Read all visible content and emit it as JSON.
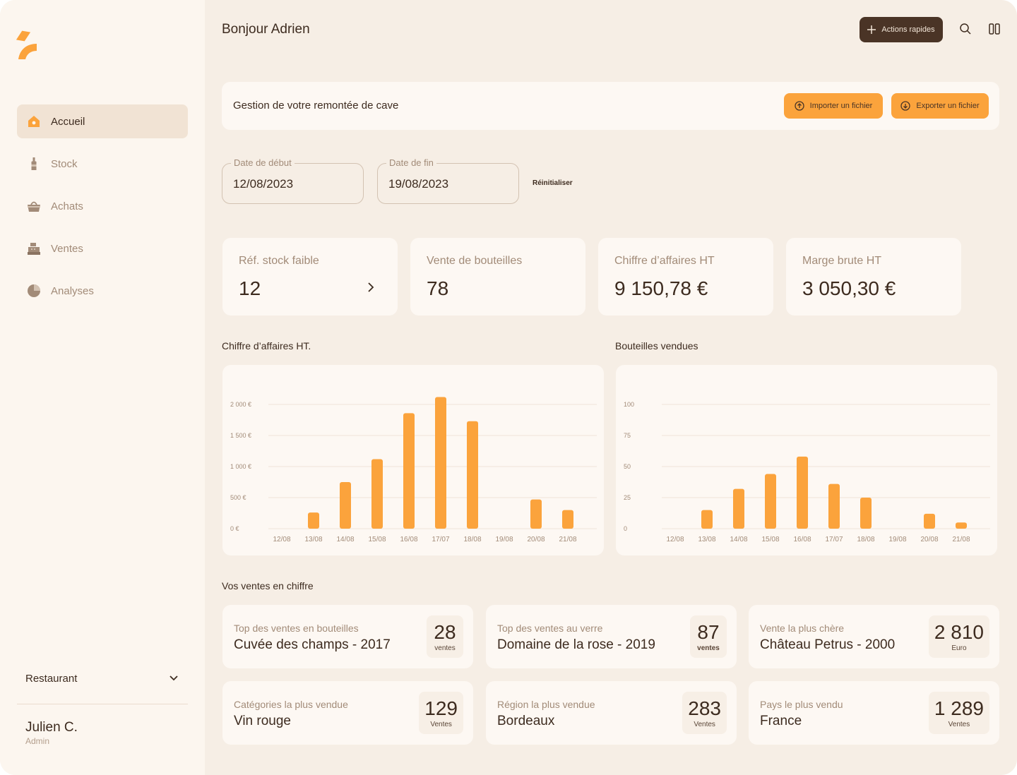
{
  "sidebar": {
    "items": [
      {
        "label": "Accueil",
        "icon": "house-icon"
      },
      {
        "label": "Stock",
        "icon": "bottle-icon"
      },
      {
        "label": "Achats",
        "icon": "basket-icon"
      },
      {
        "label": "Ventes",
        "icon": "cash-register-icon"
      },
      {
        "label": "Analyses",
        "icon": "pie-chart-icon"
      }
    ],
    "restaurant": "Restaurant",
    "user": {
      "name": "Julien C.",
      "role": "Admin"
    }
  },
  "header": {
    "greeting": "Bonjour Adrien",
    "quick_actions": "Actions rapides"
  },
  "banner": {
    "text": "Gestion de votre remontée de cave",
    "import": "Importer un fichier",
    "export": "Exporter un fichier"
  },
  "filters": {
    "start_label": "Date de début",
    "start_value": "12/08/2023",
    "end_label": "Date de fin",
    "end_value": "19/08/2023",
    "reset": "Réinitialiser"
  },
  "kpis": [
    {
      "label": "Réf. stock faible",
      "value": "12"
    },
    {
      "label": "Vente de bouteilles",
      "value": "78"
    },
    {
      "label": "Chiffre d’affaires HT",
      "value": "9 150,78 €"
    },
    {
      "label": "Marge brute HT",
      "value": "3 050,30 €"
    }
  ],
  "chart_data": [
    {
      "type": "bar",
      "title": "Chiffre d’affaires HT.",
      "categories": [
        "12/08",
        "13/08",
        "14/08",
        "15/08",
        "16/08",
        "17/07",
        "18/08",
        "19/08",
        "20/08",
        "21/08"
      ],
      "values": [
        0,
        260,
        750,
        1120,
        1860,
        2120,
        1730,
        0,
        470,
        300
      ],
      "yticks": [
        0,
        500,
        1000,
        1500,
        2000
      ],
      "ytick_labels": [
        "0 €",
        "500 €",
        "1 000 €",
        "1 500 €",
        "2 000 €"
      ],
      "ylim": [
        0,
        2000
      ],
      "grid": true,
      "color": "#fba33c"
    },
    {
      "type": "bar",
      "title": "Bouteilles vendues",
      "categories": [
        "12/08",
        "13/08",
        "14/08",
        "15/08",
        "16/08",
        "17/07",
        "18/08",
        "19/08",
        "20/08",
        "21/08"
      ],
      "values": [
        0,
        15,
        32,
        44,
        58,
        36,
        25,
        0,
        12,
        5
      ],
      "yticks": [
        0,
        25,
        50,
        75,
        100
      ],
      "ytick_labels": [
        "0",
        "25",
        "50",
        "75",
        "100"
      ],
      "ylim": [
        0,
        100
      ],
      "grid": true,
      "color": "#fba33c"
    }
  ],
  "sales": {
    "title": "Vos ventes en chiffre",
    "cards": [
      {
        "label": "Top des ventes en bouteilles",
        "value": "Cuvée des champs - 2017",
        "number": "28",
        "unit": "ventes"
      },
      {
        "label": "Top des ventes au verre",
        "value": "Domaine de la rose - 2019",
        "number": "87",
        "unit": "ventes"
      },
      {
        "label": "Vente la plus chère",
        "value": "Château Petrus - 2000",
        "number": "2 810",
        "unit": "Euro"
      },
      {
        "label": "Catégories la plus vendue",
        "value": "Vin rouge",
        "number": "129",
        "unit": "Ventes"
      },
      {
        "label": "Région la plus vendue",
        "value": "Bordeaux",
        "number": "283",
        "unit": "Ventes"
      },
      {
        "label": "Pays le plus vendu",
        "value": "France",
        "number": "1 289",
        "unit": "Ventes"
      }
    ]
  },
  "colors": {
    "accent": "#fba33c",
    "dark": "#4a3426",
    "background": "#f6eee5",
    "card": "#fdf8f3"
  }
}
